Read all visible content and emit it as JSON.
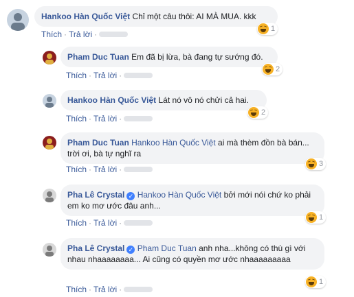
{
  "comments": [
    {
      "author": "Hankoo Hàn Quốc Việt",
      "mention": "",
      "verified": false,
      "text": "Chỉ một câu thôi: AI MÀ MUA. kkk",
      "like_label": "Thích",
      "reply_label": "Trả lời",
      "reaction_count": "1",
      "avatar_colors": [
        "#c7d3e0",
        "#6b7b8c"
      ]
    },
    {
      "author": "Pham Duc Tuan",
      "mention": "",
      "verified": false,
      "text": "Em đã bị lừa, bà đang tự sướng đó.",
      "like_label": "Thích",
      "reply_label": "Trả lời",
      "reaction_count": "2",
      "avatar_colors": [
        "#8b1e1e",
        "#e0b040"
      ]
    },
    {
      "author": "Hankoo Hàn Quốc Việt",
      "mention": "",
      "verified": false,
      "text": "Lát nó vô nó chửi cả hai.",
      "like_label": "Thích",
      "reply_label": "Trả lời",
      "reaction_count": "2",
      "avatar_colors": [
        "#c7d3e0",
        "#6b7b8c"
      ]
    },
    {
      "author": "Pham Duc Tuan",
      "mention": "Hankoo Hàn Quốc Việt",
      "verified": false,
      "text": "ai mà thèm đồn bà bán... trời ơi, bà tự nghĩ ra",
      "like_label": "Thích",
      "reply_label": "Trả lời",
      "reaction_count": "3",
      "avatar_colors": [
        "#8b1e1e",
        "#e0b040"
      ]
    },
    {
      "author": "Pha Lê Crystal",
      "mention": "Hankoo Hàn Quốc Việt",
      "verified": true,
      "text": "bởi mới nói chứ ko phải em ko mơ ước đâu anh...",
      "like_label": "Thích",
      "reply_label": "Trả lời",
      "reaction_count": "1",
      "avatar_colors": [
        "#d8d8d8",
        "#7a7a7a"
      ]
    },
    {
      "author": "Pha Lê Crystal",
      "mention": "Pham Duc Tuan",
      "verified": true,
      "text": "anh nha...không có thù gì với nhau nhaaaaaaaa... Ai cũng có quyền mơ ước nhaaaaaaaaa",
      "like_label": "Thích",
      "reply_label": "Trả lời",
      "reaction_count": "1",
      "avatar_colors": [
        "#d8d8d8",
        "#7a7a7a"
      ]
    }
  ]
}
